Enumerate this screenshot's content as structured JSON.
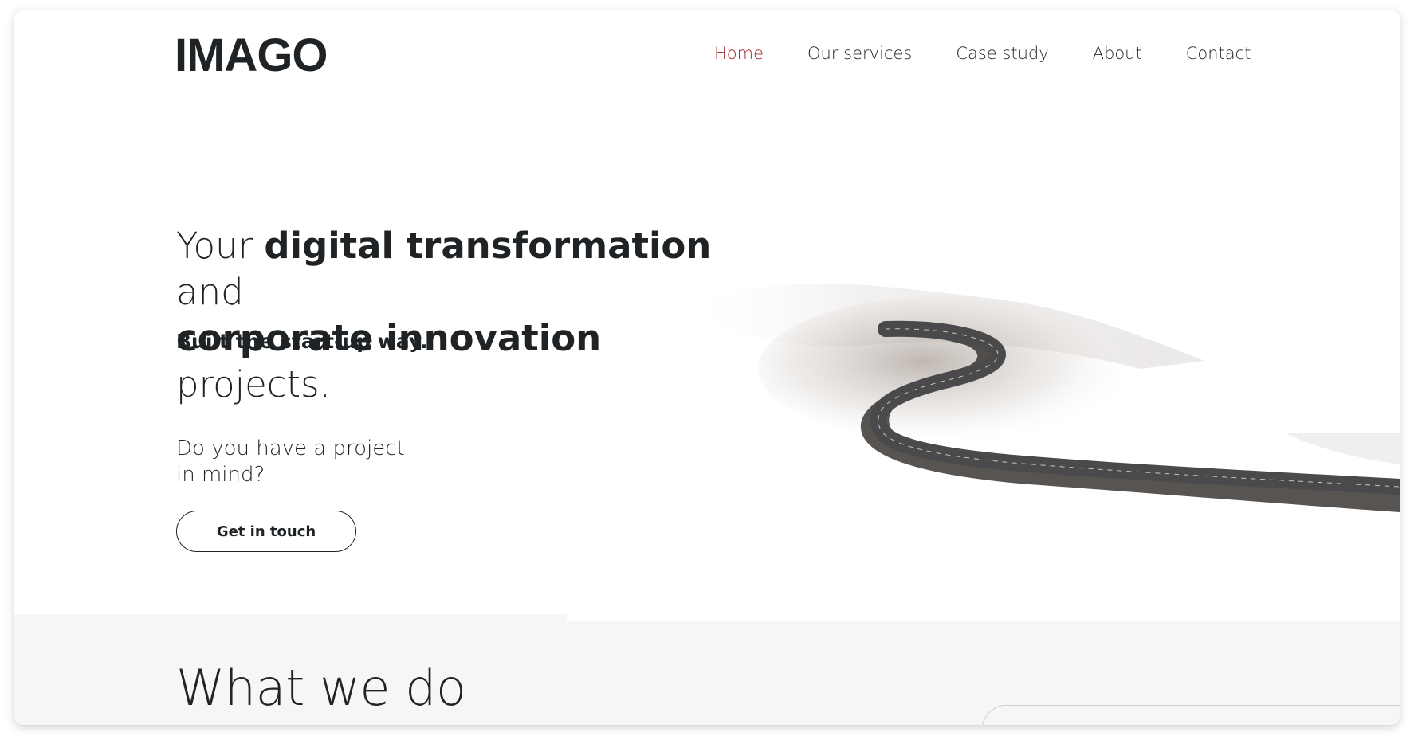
{
  "header": {
    "logo": "IMAGO",
    "nav": [
      {
        "label": "Home",
        "active": true
      },
      {
        "label": "Our services"
      },
      {
        "label": "Case study"
      },
      {
        "label": "About"
      },
      {
        "label": "Contact"
      }
    ]
  },
  "hero": {
    "title_part1": "Your ",
    "title_bold1": "digital transformation",
    "title_part2": " and",
    "title_bold2": "corporate innovation",
    "title_part3": " projects.",
    "tagline": "Built the start-up way.",
    "question_line1": "Do you have a project",
    "question_line2": "in mind?",
    "cta_label": "Get in touch",
    "image": "winding-road-snow-image"
  },
  "section": {
    "title": "What we do"
  },
  "colors": {
    "accent": "#a5282c",
    "text": "#1f2325",
    "band": "#f6f6f6"
  }
}
